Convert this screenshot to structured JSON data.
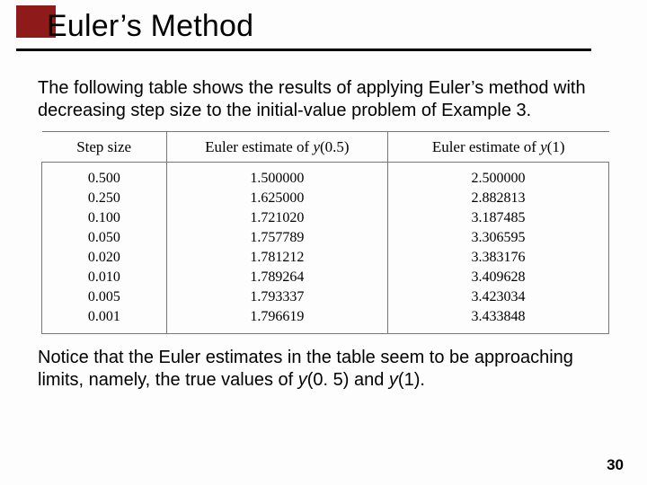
{
  "title": "Euler’s Method",
  "intro": "The following table shows the results of applying Euler’s method with decreasing step size to the initial-value problem of Example 3.",
  "table": {
    "headers": {
      "step": "Step size",
      "est05_prefix": "Euler estimate of ",
      "est05_var": "y",
      "est05_arg": "(0.5)",
      "est1_prefix": "Euler estimate of ",
      "est1_var": "y",
      "est1_arg": "(1)"
    },
    "rows": [
      {
        "step": "0.500",
        "e05": "1.500000",
        "e1": "2.500000"
      },
      {
        "step": "0.250",
        "e05": "1.625000",
        "e1": "2.882813"
      },
      {
        "step": "0.100",
        "e05": "1.721020",
        "e1": "3.187485"
      },
      {
        "step": "0.050",
        "e05": "1.757789",
        "e1": "3.306595"
      },
      {
        "step": "0.020",
        "e05": "1.781212",
        "e1": "3.383176"
      },
      {
        "step": "0.010",
        "e05": "1.789264",
        "e1": "3.409628"
      },
      {
        "step": "0.005",
        "e05": "1.793337",
        "e1": "3.423034"
      },
      {
        "step": "0.001",
        "e05": "1.796619",
        "e1": "3.433848"
      }
    ]
  },
  "outro_parts": {
    "p1": "Notice that the Euler estimates in the table seem to be approaching limits, namely, the true values of ",
    "y1": "y",
    "a1": "(0. 5) and ",
    "y2": "y",
    "a2": "(1)."
  },
  "page_number": "30",
  "chart_data": {
    "type": "table",
    "title": "Euler's method estimates with decreasing step size",
    "columns": [
      "Step size",
      "Euler estimate of y(0.5)",
      "Euler estimate of y(1)"
    ],
    "rows": [
      [
        0.5,
        1.5,
        2.5
      ],
      [
        0.25,
        1.625,
        2.882813
      ],
      [
        0.1,
        1.72102,
        3.187485
      ],
      [
        0.05,
        1.757789,
        3.306595
      ],
      [
        0.02,
        1.781212,
        3.383176
      ],
      [
        0.01,
        1.789264,
        3.409628
      ],
      [
        0.005,
        1.793337,
        3.423034
      ],
      [
        0.001,
        1.796619,
        3.433848
      ]
    ]
  }
}
